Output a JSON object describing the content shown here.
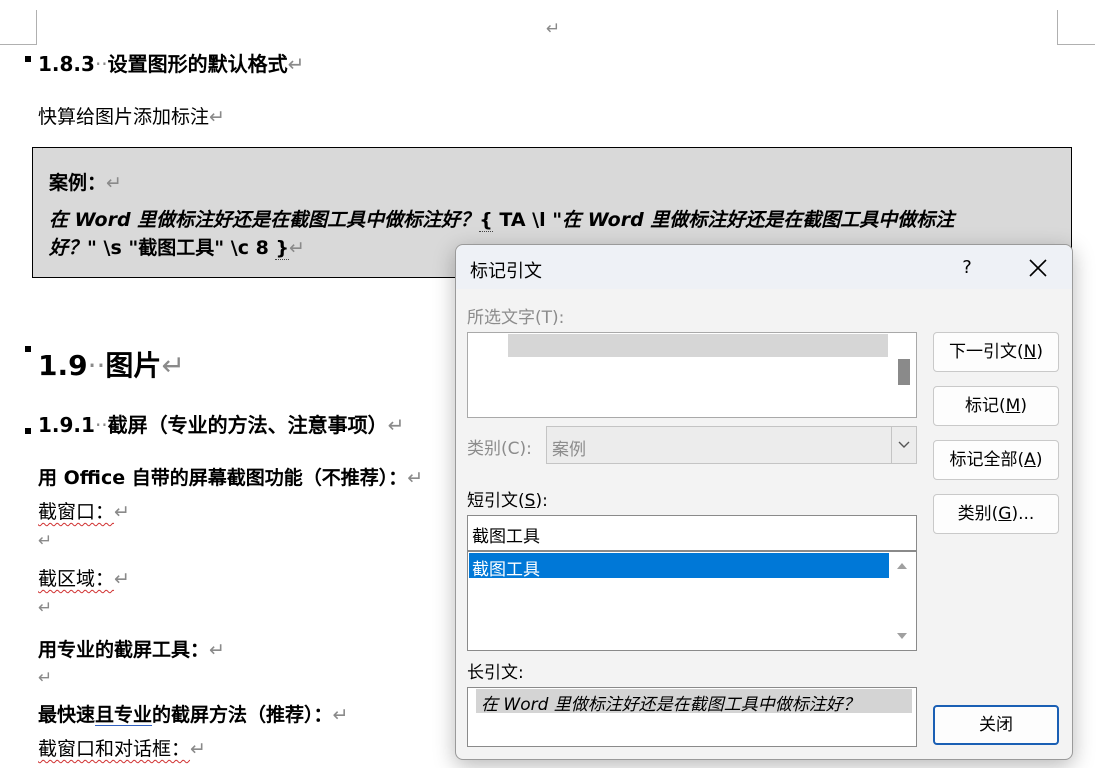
{
  "document": {
    "pm_top": "↵",
    "h_183_num": "1.8.3",
    "h_183_title": "设置图形的默认格式",
    "quick_text": "快算给图片添加标注",
    "case_title": "案例：",
    "case_q1": "在 Word 里做标注好还是在截图工具中做标注好？",
    "field_open": "{",
    "field_code1": " TA \\l \"",
    "case_q2": "在 Word 里做标注好还是在截图工具中做标注",
    "case_q3": "好？",
    "field_code2": "\" \\s \"截图工具\" \\c 8 ",
    "field_close": "}",
    "h_19_num": "1.9",
    "h_19_title": "图片",
    "h_191_num": "1.9.1",
    "h_191_title": "截屏（专业的方法、注意事项）",
    "office_text": "用 Office 自带的屏幕截图功能（不推荐）：",
    "window_text": "截窗口：",
    "area_text": "截区域：",
    "pro_tool_text": "用专业的截屏工具：",
    "fastest_pre": "最快速",
    "fastest_and": "且专业",
    "fastest_post": "的截屏方法（推荐）：",
    "window_dialog_text": "截窗口和对话框："
  },
  "dialog": {
    "title": "标记引文",
    "help": "?",
    "selected_text_label": "所选文字(T):",
    "category_label": "类别(C):",
    "category_value": "案例",
    "short_citation_label_pre": "短引文(",
    "short_citation_label_key": "S",
    "short_citation_label_post": "):",
    "short_citation_value": "截图工具",
    "short_list": [
      "截图工具"
    ],
    "long_citation_label": "长引文:",
    "long_citation_value": "在 Word 里做标注好还是在截图工具中做标注好？",
    "buttons": {
      "next_pre": "下一引文(",
      "next_key": "N",
      "next_post": ")",
      "mark_pre": "标记(",
      "mark_key": "M",
      "mark_post": ")",
      "mark_all_pre": "标记全部(",
      "mark_all_key": "A",
      "mark_all_post": ")",
      "category_pre": "类别(",
      "category_key": "G",
      "category_post": ")...",
      "close": "关闭"
    },
    "selected_color": "#0078d7"
  }
}
